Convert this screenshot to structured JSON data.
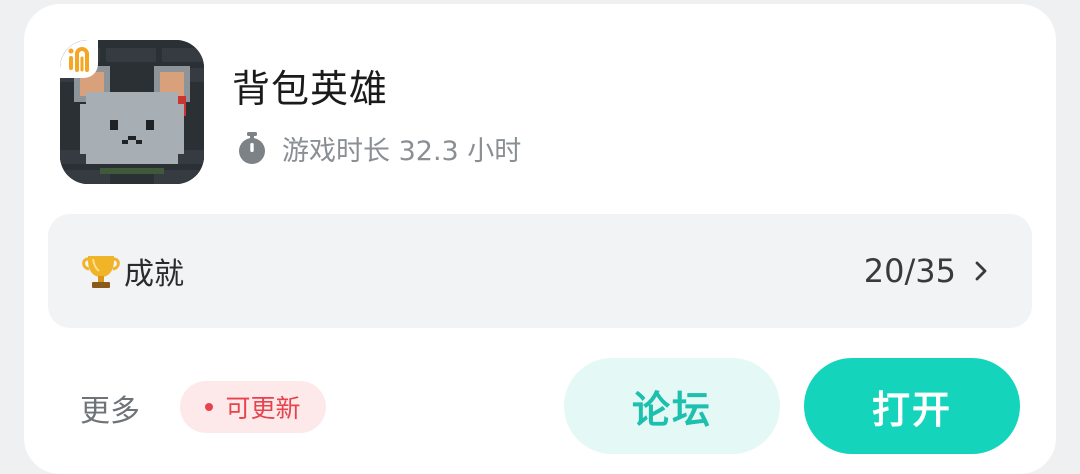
{
  "game": {
    "title": "背包英雄",
    "icon": "pixel-mouse-game-icon",
    "badge_icon": "orange-brand-badge-icon",
    "playtime": "游戏时长 32.3 小时"
  },
  "achievements": {
    "label": "成就",
    "progress": "20/35",
    "icon": "trophy-icon"
  },
  "actions": {
    "more_label": "更多",
    "update_badge": "可更新",
    "forum_button": "论坛",
    "open_button": "打开"
  },
  "colors": {
    "accent": "#15d4bc",
    "accent_light": "#e4f8f6",
    "update_red": "#e8434c",
    "update_bg": "#fde9ea",
    "panel_bg": "#f2f3f5"
  }
}
